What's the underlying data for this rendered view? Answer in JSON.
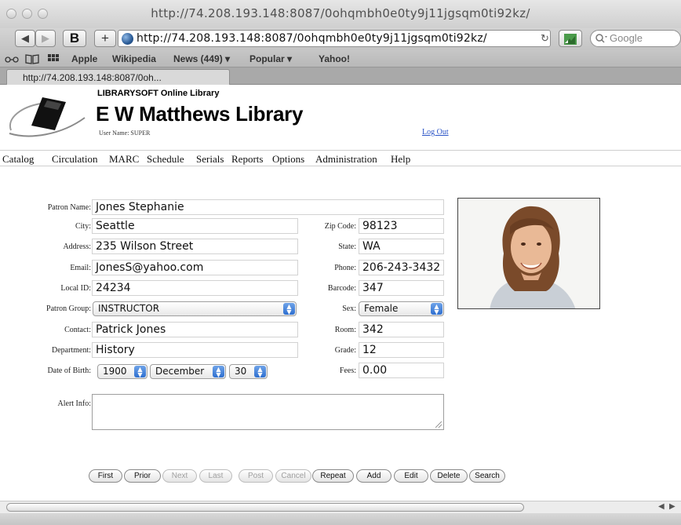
{
  "window": {
    "title": "http://74.208.193.148:8087/0ohqmbh0e0ty9j11jgsqm0ti92kz/"
  },
  "toolbar": {
    "bold_button": "B",
    "add_button": "+",
    "url": "http://74.208.193.148:8087/0ohqmbh0e0ty9j11jgsqm0ti92kz/",
    "search_placeholder": "Google"
  },
  "bookmarks": [
    "Apple",
    "Wikipedia",
    "News (449) ▾",
    "Popular ▾",
    "Yahoo!"
  ],
  "tab": {
    "title": "http://74.208.193.148:8087/0oh..."
  },
  "brand": {
    "small": "LIBRARYSOFT Online Library",
    "big": "E W Matthews Library",
    "user_name": "User Name: SUPER",
    "logout": "Log Out"
  },
  "menu": [
    "Catalog",
    "Circulation",
    "MARC",
    "Schedule",
    "Serials",
    "Reports",
    "Options",
    "Administration",
    "Help"
  ],
  "form": {
    "patron_name": {
      "label": "Patron Name:",
      "value": "Jones Stephanie"
    },
    "city": {
      "label": "City:",
      "value": "Seattle"
    },
    "address": {
      "label": "Address:",
      "value": "235 Wilson Street"
    },
    "email": {
      "label": "Email:",
      "value": "JonesS@yahoo.com"
    },
    "local_id": {
      "label": "Local ID:",
      "value": "24234"
    },
    "patron_group": {
      "label": "Patron Group:",
      "value": "INSTRUCTOR"
    },
    "contact": {
      "label": "Contact:",
      "value": "Patrick Jones"
    },
    "department": {
      "label": "Department:",
      "value": "History"
    },
    "dob": {
      "label": "Date of Birth:",
      "year": "1900",
      "month": "December",
      "day": "30"
    },
    "zip": {
      "label": "Zip Code:",
      "value": "98123"
    },
    "state": {
      "label": "State:",
      "value": "WA"
    },
    "phone": {
      "label": "Phone:",
      "value": "206-243-3432"
    },
    "barcode": {
      "label": "Barcode:",
      "value": "347"
    },
    "sex": {
      "label": "Sex:",
      "value": "Female"
    },
    "room": {
      "label": "Room:",
      "value": "342"
    },
    "grade": {
      "label": "Grade:",
      "value": "12"
    },
    "fees": {
      "label": "Fees:",
      "value": "0.00"
    },
    "alert": {
      "label": "Alert Info:",
      "value": ""
    }
  },
  "buttons": {
    "first": "First",
    "prior": "Prior",
    "next": "Next",
    "last": "Last",
    "post": "Post",
    "cancel": "Cancel",
    "repeat": "Repeat",
    "add": "Add",
    "edit": "Edit",
    "delete": "Delete",
    "search": "Search"
  },
  "colors": {
    "link": "#2b54c7",
    "select_arrow": "#2e6fd0",
    "disabled_text": "#a0a0a0"
  }
}
